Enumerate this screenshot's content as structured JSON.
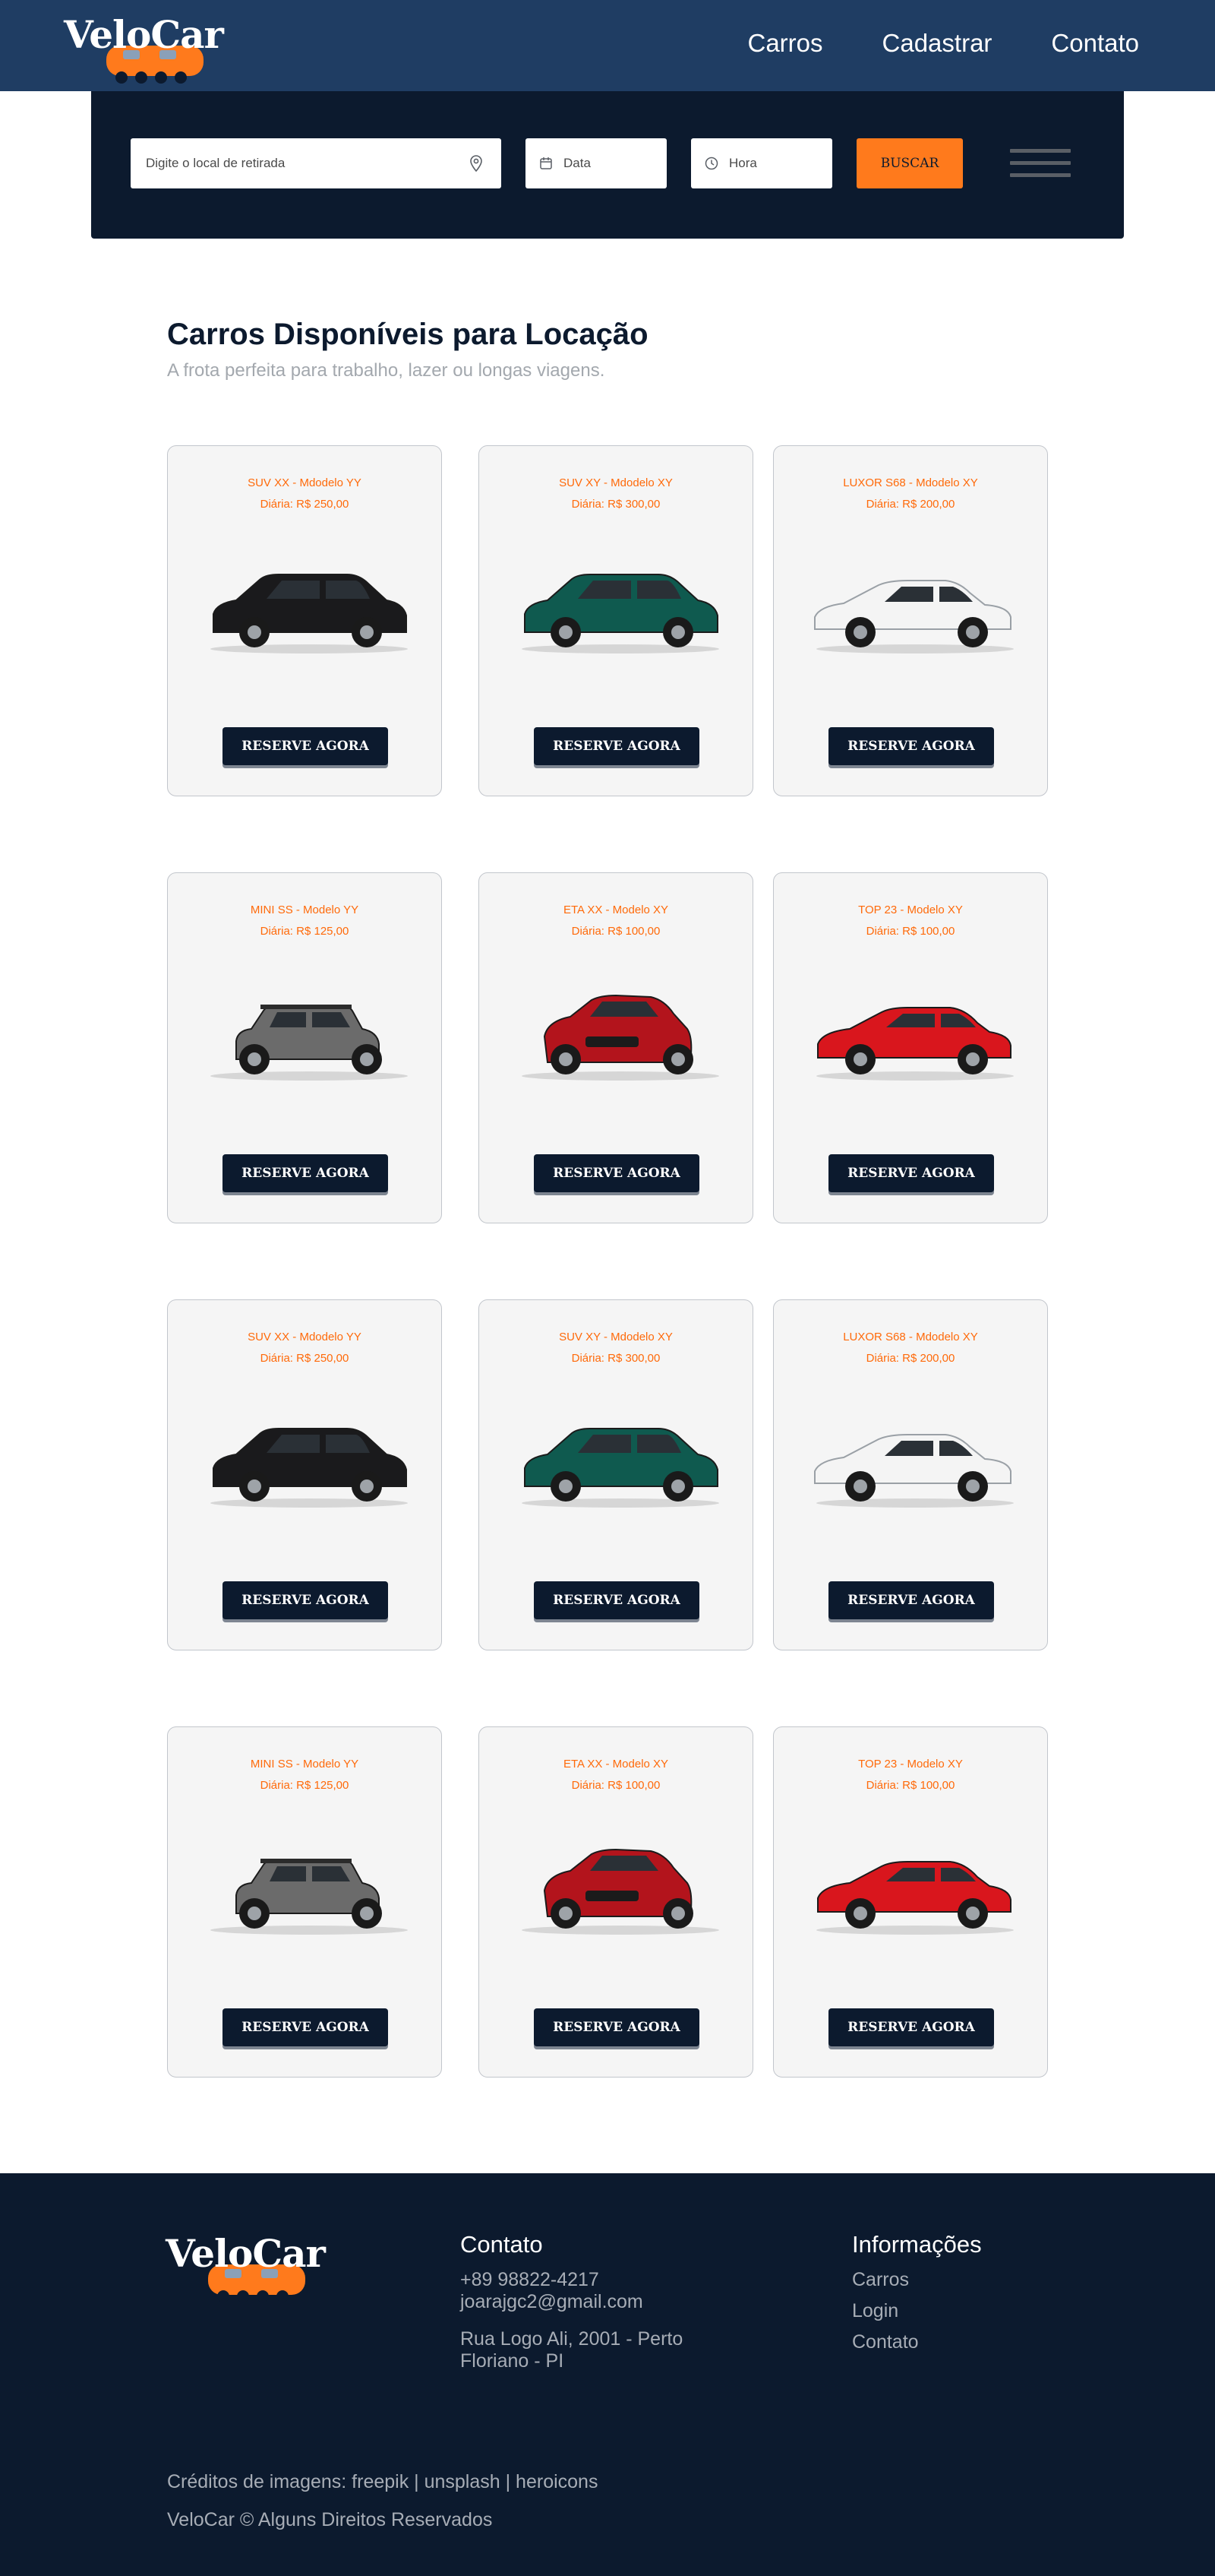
{
  "brand": {
    "name": "VeloCar",
    "accent": "#ff7a1c",
    "navy": "#0c1a2e",
    "header_blue": "#1f3d63"
  },
  "nav": {
    "items": [
      "Carros",
      "Cadastrar",
      "Contato"
    ]
  },
  "search": {
    "location_placeholder": "Digite o local de retirada",
    "date_placeholder": "Data",
    "time_placeholder": "Hora",
    "button_label": "BUSCAR"
  },
  "section": {
    "title": "Carros Disponíveis para Locação",
    "subtitle": "A frota perfeita para trabalho, lazer ou longas viagens."
  },
  "cards": [
    {
      "name": "SUV XX - Mdodelo YY",
      "price": "Diária: R$ 250,00",
      "button": "RESERVE AGORA",
      "car": "suv",
      "color": "#1a1a1c"
    },
    {
      "name": "SUV XY - Mdodelo XY",
      "price": "Diária: R$ 300,00",
      "button": "RESERVE AGORA",
      "car": "suv-large",
      "color": "#0f5a4f"
    },
    {
      "name": "LUXOR S68 - Mdodelo XY",
      "price": "Diária: R$ 200,00",
      "button": "RESERVE AGORA",
      "car": "sedan",
      "color": "#f4f4f4"
    },
    {
      "name": "MINI SS - Modelo YY",
      "price": "Diária: R$ 125,00",
      "button": "RESERVE AGORA",
      "car": "mini",
      "color": "#6b6b6b"
    },
    {
      "name": "ETA XX - Modelo XY",
      "price": "Diária: R$ 100,00",
      "button": "RESERVE AGORA",
      "car": "crossover-front",
      "color": "#b3141c"
    },
    {
      "name": "TOP 23 - Modelo XY",
      "price": "Diária: R$ 100,00",
      "button": "RESERVE AGORA",
      "car": "hatch",
      "color": "#d9161d"
    },
    {
      "name": "SUV XX - Mdodelo YY",
      "price": "Diária: R$ 250,00",
      "button": "RESERVE AGORA",
      "car": "suv",
      "color": "#1a1a1c"
    },
    {
      "name": "SUV XY - Mdodelo XY",
      "price": "Diária: R$ 300,00",
      "button": "RESERVE AGORA",
      "car": "suv-large",
      "color": "#0f5a4f"
    },
    {
      "name": "LUXOR S68 - Mdodelo XY",
      "price": "Diária: R$ 200,00",
      "button": "RESERVE AGORA",
      "car": "sedan",
      "color": "#f4f4f4"
    },
    {
      "name": "MINI SS - Modelo YY",
      "price": "Diária: R$ 125,00",
      "button": "RESERVE AGORA",
      "car": "mini",
      "color": "#6b6b6b"
    },
    {
      "name": "ETA XX - Modelo XY",
      "price": "Diária: R$ 100,00",
      "button": "RESERVE AGORA",
      "car": "crossover-front",
      "color": "#b3141c"
    },
    {
      "name": "TOP 23 - Modelo XY",
      "price": "Diária: R$ 100,00",
      "button": "RESERVE AGORA",
      "car": "hatch",
      "color": "#d9161d"
    }
  ],
  "footer": {
    "contato": {
      "title": "Contato",
      "phone": "+89 98822-4217",
      "email": "joarajgc2@gmail.com",
      "address": "Rua Logo Ali, 2001 - Perto Floriano - PI"
    },
    "info": {
      "title": "Informações",
      "links": [
        "Carros",
        "Login",
        "Contato"
      ]
    },
    "credits": "Créditos de imagens: freepik | unsplash | heroicons",
    "copyright": "VeloCar © Alguns Direitos Reservados"
  }
}
